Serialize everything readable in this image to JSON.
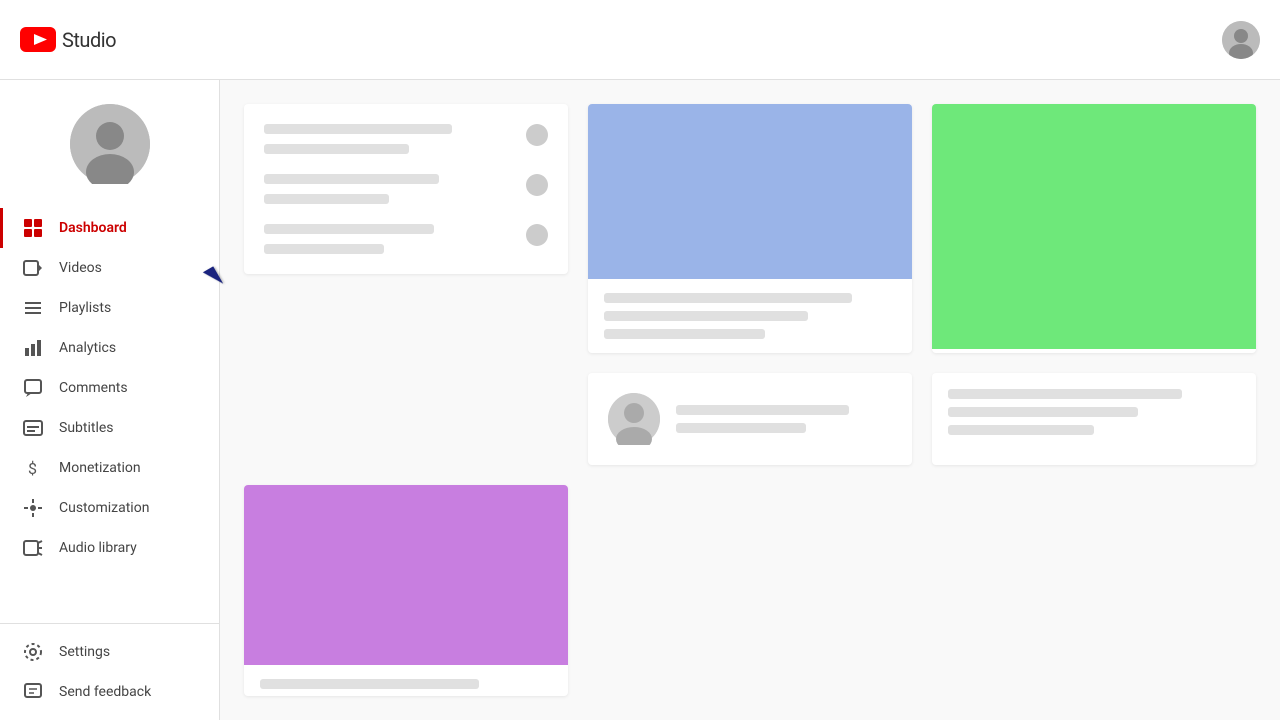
{
  "header": {
    "title": "Studio",
    "logo_alt": "YouTube Studio"
  },
  "sidebar": {
    "nav_items": [
      {
        "id": "dashboard",
        "label": "Dashboard",
        "icon": "grid",
        "active": true
      },
      {
        "id": "videos",
        "label": "Videos",
        "icon": "video",
        "active": false
      },
      {
        "id": "playlists",
        "label": "Playlists",
        "icon": "list",
        "active": false
      },
      {
        "id": "analytics",
        "label": "Analytics",
        "icon": "bar-chart",
        "active": false
      },
      {
        "id": "comments",
        "label": "Comments",
        "icon": "comment",
        "active": false
      },
      {
        "id": "subtitles",
        "label": "Subtitles",
        "icon": "subtitles",
        "active": false
      },
      {
        "id": "monetization",
        "label": "Monetization",
        "icon": "dollar",
        "active": false
      },
      {
        "id": "customization",
        "label": "Customization",
        "icon": "brush",
        "active": false
      },
      {
        "id": "audio-library",
        "label": "Audio library",
        "icon": "audio",
        "active": false
      }
    ],
    "bottom_items": [
      {
        "id": "settings",
        "label": "Settings",
        "icon": "gear"
      },
      {
        "id": "send-feedback",
        "label": "Send feedback",
        "icon": "feedback"
      }
    ]
  },
  "colors": {
    "active": "#cc0000",
    "card1_bg": "#9ab4e8",
    "card2_bg": "#6ee87a",
    "card7_bg": "#c87ee0",
    "line_bg": "#e0e0e0",
    "avatar_bg": "#bbb"
  }
}
